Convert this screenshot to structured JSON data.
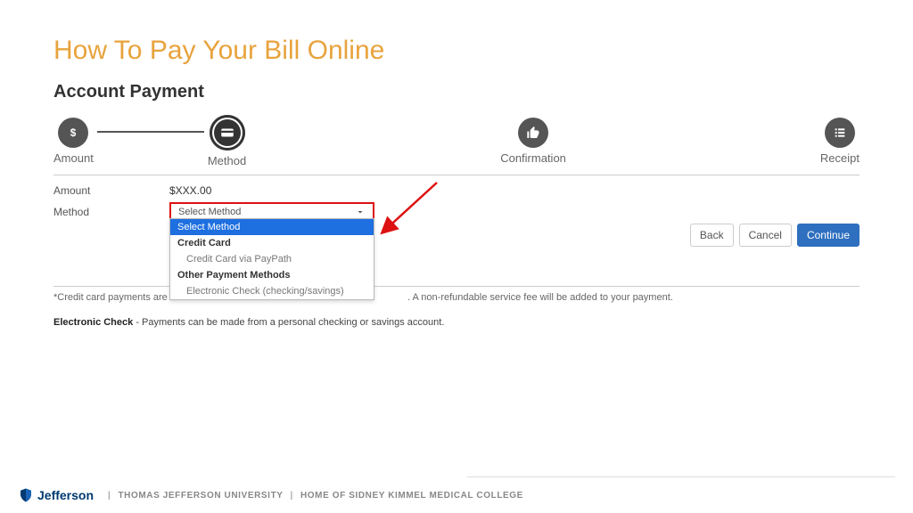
{
  "title": "How To Pay Your Bill Online",
  "panel_title": "Account Payment",
  "steps": [
    {
      "label": "Amount",
      "icon": "dollar"
    },
    {
      "label": "Method",
      "icon": "card"
    },
    {
      "label": "Confirmation",
      "icon": "thumb"
    },
    {
      "label": "Receipt",
      "icon": "list"
    }
  ],
  "form": {
    "amount_label": "Amount",
    "amount_value": "$XXX.00",
    "method_label": "Method",
    "method_select_placeholder": "Select Method"
  },
  "dropdown": {
    "selected": "Select Method",
    "group1": "Credit Card",
    "group1_sub": "Credit Card via PayPath",
    "group2": "Other Payment Methods",
    "group2_sub": "Electronic Check (checking/savings)"
  },
  "buttons": {
    "back": "Back",
    "cancel": "Cancel",
    "continue": "Continue"
  },
  "notes": {
    "credit_note_prefix": "*Credit card payments are ha",
    "credit_note_suffix": ". A non-refundable service fee will be added to your payment.",
    "echeck_bold": "Electronic Check",
    "echeck_rest": " - Payments can be made from a personal checking or savings account."
  },
  "footer": {
    "brand": "Jefferson",
    "line1": "THOMAS JEFFERSON UNIVERSITY",
    "line2": "HOME OF SIDNEY KIMMEL MEDICAL COLLEGE"
  }
}
